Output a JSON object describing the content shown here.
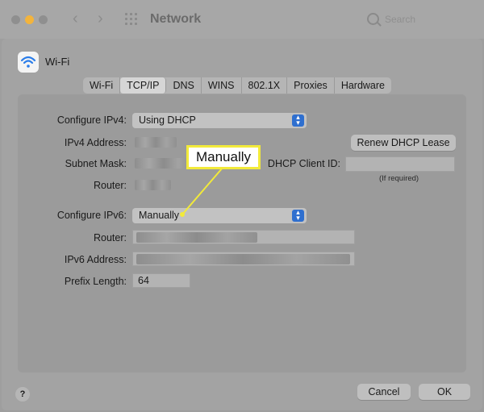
{
  "window": {
    "title": "Network",
    "search_placeholder": "Search"
  },
  "header": {
    "interface_label": "Wi-Fi"
  },
  "tabs": [
    {
      "label": "Wi-Fi"
    },
    {
      "label": "TCP/IP",
      "active": true
    },
    {
      "label": "DNS"
    },
    {
      "label": "WINS"
    },
    {
      "label": "802.1X"
    },
    {
      "label": "Proxies"
    },
    {
      "label": "Hardware"
    }
  ],
  "form": {
    "configure_ipv4_label": "Configure IPv4:",
    "configure_ipv4_value": "Using DHCP",
    "ipv4_address_label": "IPv4 Address:",
    "subnet_mask_label": "Subnet Mask:",
    "router_label": "Router:",
    "renew_button": "Renew DHCP Lease",
    "dhcp_client_id_label": "DHCP Client ID:",
    "dhcp_client_id_value": "",
    "dhcp_hint": "(If required)",
    "configure_ipv6_label": "Configure IPv6:",
    "configure_ipv6_value": "Manually",
    "router6_label": "Router:",
    "ipv6_address_label": "IPv6 Address:",
    "prefix_length_label": "Prefix Length:",
    "prefix_length_value": "64"
  },
  "footer": {
    "help": "?",
    "cancel": "Cancel",
    "ok": "OK"
  },
  "annotation": {
    "callout_text": "Manually",
    "callout_color": "#f2ea3a"
  },
  "icons": [
    "wifi-icon",
    "help-icon",
    "search-icon",
    "grid-icon",
    "chevron-left-icon",
    "chevron-right-icon",
    "stepper-icon"
  ]
}
